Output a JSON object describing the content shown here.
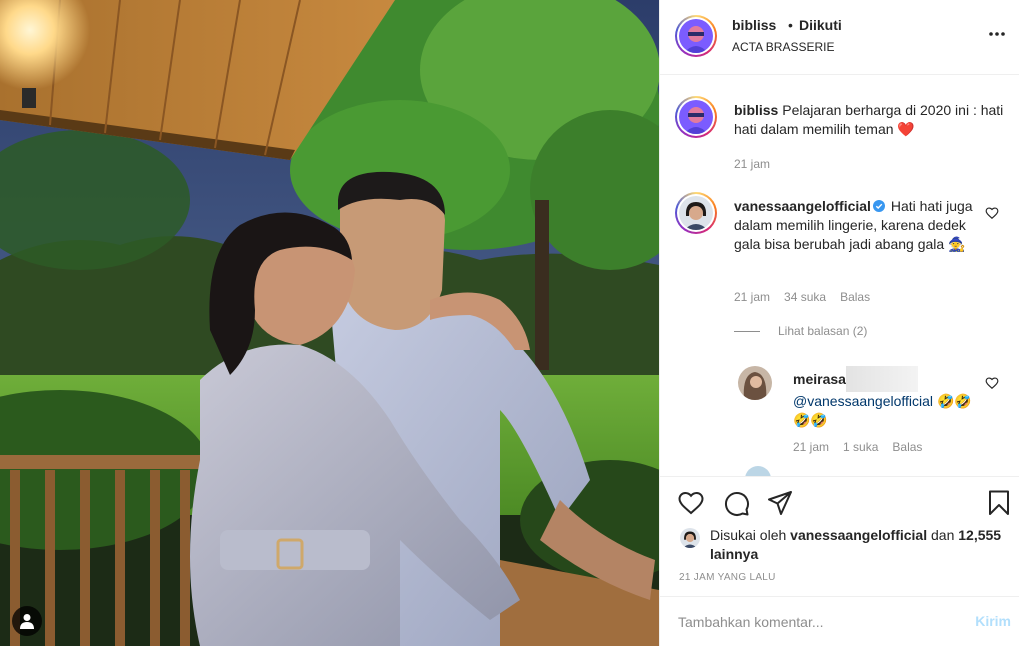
{
  "post": {
    "username": "bibliss",
    "separator": "•",
    "follow_state": "Diikuti",
    "location": "ACTA BRASSERIE"
  },
  "caption": {
    "username": "bibliss",
    "text": "Pelajaran berharga di 2020 ini : hati hati dalam memilih teman",
    "emoji": "❤️",
    "time": "21 jam"
  },
  "comments": [
    {
      "username": "vanessaangelofficial",
      "verified": true,
      "text": "Hati hati juga dalam memilih lingerie, karena dedek gala bisa berubah jadi abang gala",
      "emoji": "🧙",
      "time": "21 jam",
      "likes": "34 suka",
      "reply_label": "Balas",
      "view_replies": "Lihat balasan (2)",
      "replies": [
        {
          "username": "meirasa",
          "mention": "@vanessaangelofficial",
          "emoji": "🤣🤣🤣🤣",
          "time": "21 jam",
          "likes": "1 suka",
          "reply_label": "Balas"
        }
      ]
    }
  ],
  "likes": {
    "prefix": "Disukai oleh",
    "user": "vanessaangelofficial",
    "and": "dan",
    "others": "12,555 lainnya"
  },
  "timestamp": "21 JAM YANG LALU",
  "add_comment": {
    "placeholder": "Tambahkan komentar...",
    "post_label": "Kirim"
  },
  "colors": {
    "link_blue": "#00376b",
    "verified_blue": "#3897f0",
    "muted": "#8e8e8e",
    "post_disabled": "#b2dffc",
    "heart_red": "#ed4956"
  }
}
